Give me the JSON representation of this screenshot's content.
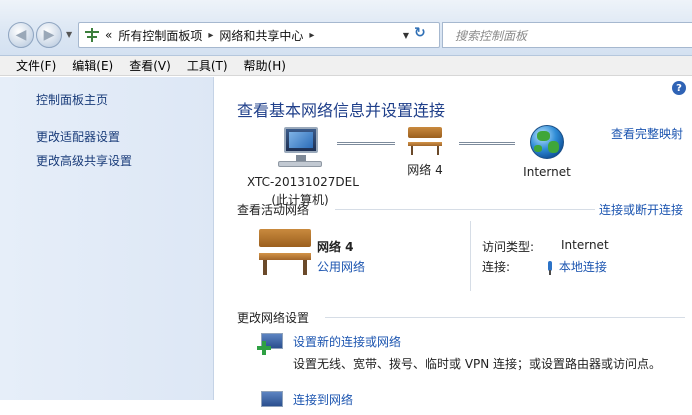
{
  "address_bar": {
    "back_glyph": "◀",
    "forward_glyph": "▶",
    "path_prefix": "«",
    "path_parent": "所有控制面板项",
    "path_current": "网络和共享中心",
    "refresh_glyph": "↻",
    "search_placeholder": "搜索控制面板"
  },
  "menubar": {
    "file": "文件(F)",
    "edit": "编辑(E)",
    "view": "查看(V)",
    "tools": "工具(T)",
    "help": "帮助(H)"
  },
  "sidebar": {
    "items": [
      {
        "label": "控制面板主页"
      },
      {
        "label": "更改适配器设置"
      },
      {
        "label": "更改高级共享设置"
      }
    ]
  },
  "main": {
    "help_glyph": "?",
    "title": "查看基本网络信息并设置连接",
    "full_map_link": "查看完整映射",
    "network_map": {
      "computer_name": "XTC-20131027DEL",
      "computer_note": "(此计算机)",
      "network_name": "网络 4",
      "internet_name": "Internet"
    },
    "active_networks": {
      "section_title": "查看活动网络",
      "connect_disconnect_link": "连接或断开连接",
      "network_name": "网络 4",
      "network_type": "公用网络",
      "access_type_label": "访问类型:",
      "access_type_value": "Internet",
      "connections_label": "连接:",
      "connections_value": "本地连接"
    },
    "change_settings": {
      "section_title": "更改网络设置",
      "tasks": [
        {
          "title": "设置新的连接或网络",
          "description": "设置无线、宽带、拨号、临时或 VPN 连接；或设置路由器或访问点。"
        },
        {
          "title": "连接到网络",
          "description": ""
        }
      ]
    }
  },
  "colors": {
    "link": "#1c55b0",
    "title": "#1f3f8a",
    "sidebar_bg": "#dde7f5"
  }
}
